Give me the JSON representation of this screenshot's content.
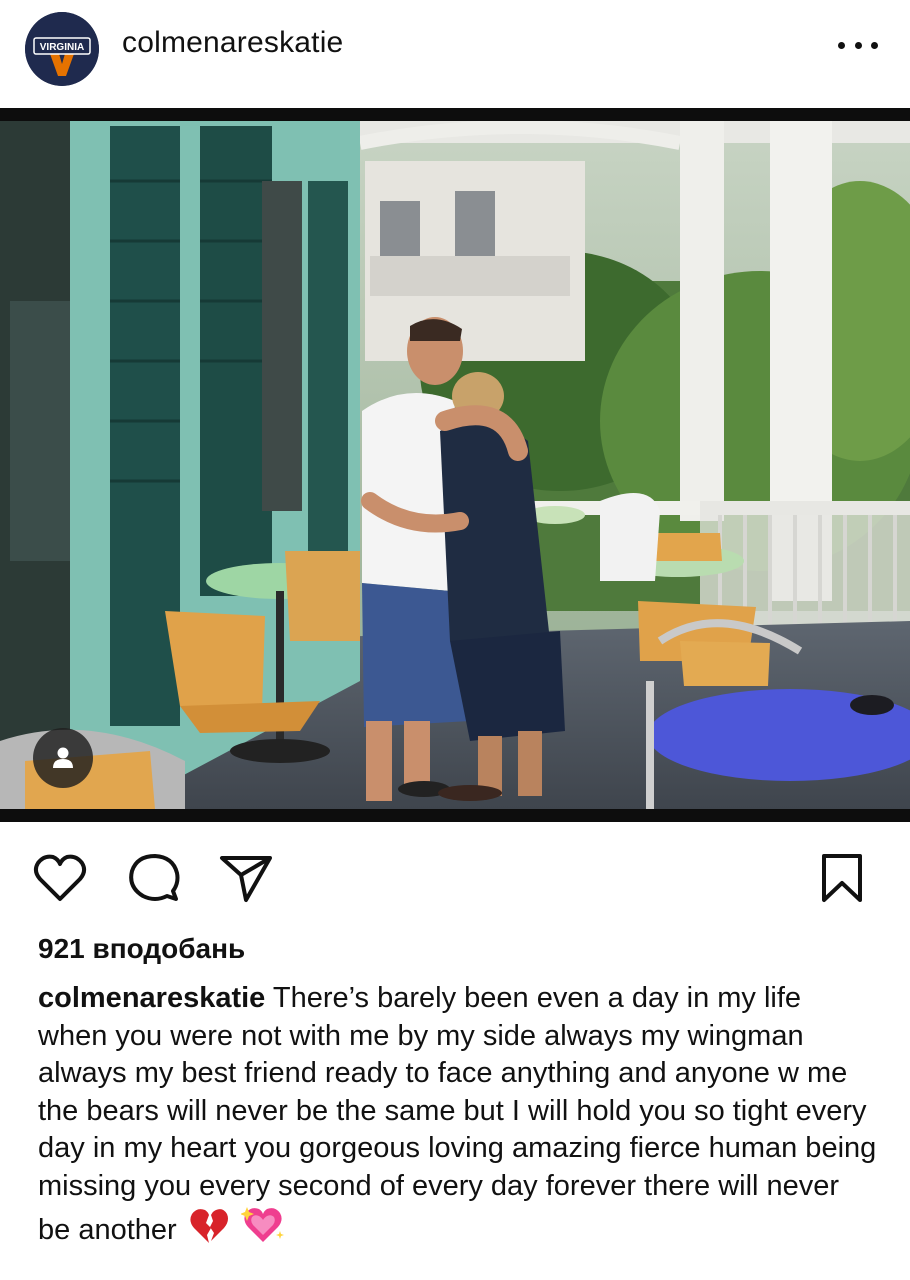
{
  "post": {
    "username": "colmenareskatie",
    "avatar": {
      "text": "VIRGINIA",
      "bg": "#1f2a4e",
      "accent": "#e57200"
    },
    "more_icon": "more-horizontal-icon",
    "tag_icon": "user-tag-icon"
  },
  "actions": {
    "like_icon": "heart-icon",
    "comment_icon": "comment-icon",
    "share_icon": "send-icon",
    "save_icon": "bookmark-icon"
  },
  "likes": "921 вподобань",
  "caption": {
    "username": "colmenareskatie",
    "text": "There’s barely been even a day in my life when you were not with me by my side always my wingman always my best friend ready to face anything and anyone  w me the bears will never be the same but I will hold you so tight every day in my heart you gorgeous loving amazing fierce human being missing you every second of every day forever there will never be another",
    "emojis": [
      "broken-heart-emoji",
      "sparkling-heart-emoji"
    ]
  },
  "colors": {
    "text": "#111111",
    "background": "#ffffff",
    "frame": "#0d0d0d"
  }
}
